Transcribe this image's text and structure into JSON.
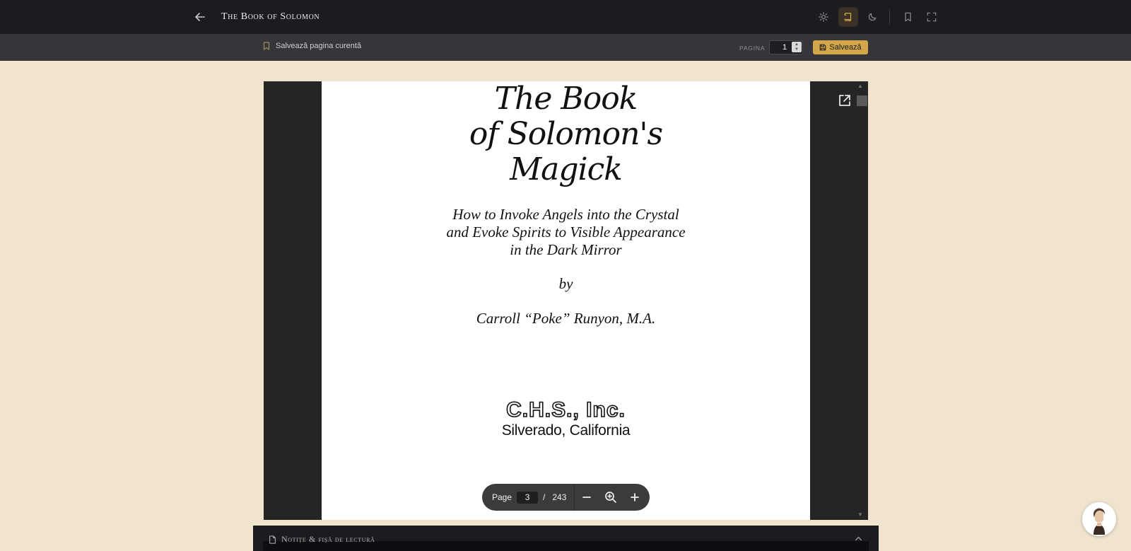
{
  "header": {
    "back_icon": "arrow-left-icon",
    "title": "The Book of Solomon",
    "icons": [
      "sun-icon",
      "scroll-icon",
      "moon-icon",
      "bookmark-icon",
      "fullscreen-icon"
    ],
    "active_theme": "sepia",
    "accent_color": "#d4a64a"
  },
  "subbar": {
    "save_current_label": "Salvează pagina curentă",
    "page_label": "PAGINA",
    "page_value": "1",
    "save_button_label": "Salvează"
  },
  "pdf": {
    "title_lines": [
      "The Book",
      "of Solomon's",
      "Magick"
    ],
    "subtitle_lines": [
      "How to Invoke Angels into the Crystal",
      "and Evoke Spirits to Visible Appearance",
      "in the Dark Mirror"
    ],
    "by": "by",
    "author": "Carroll “Poke” Runyon, M.A.",
    "publisher": "C.H.S., Inc.",
    "place": "Silverado, California"
  },
  "pdf_toolbar": {
    "page_label": "Page",
    "current_page": "3",
    "separator": "/",
    "total_pages": "243"
  },
  "notes": {
    "label": "Notițe & fișă de lectură"
  }
}
